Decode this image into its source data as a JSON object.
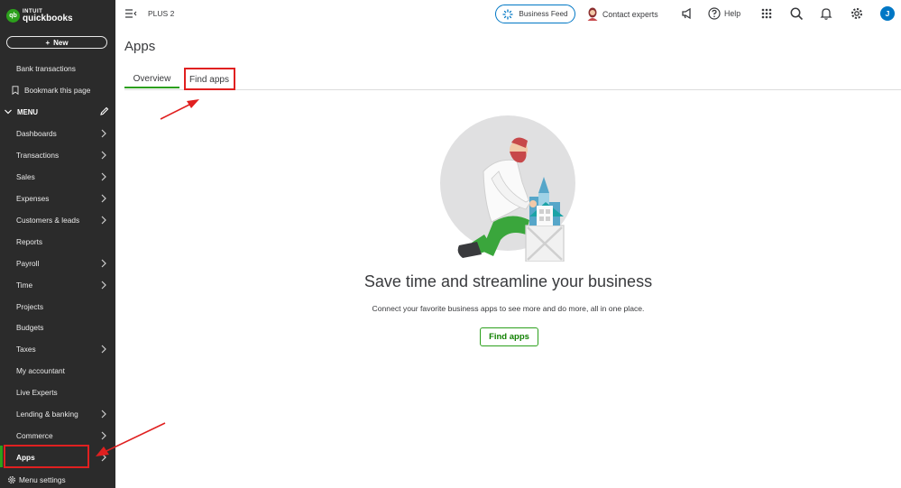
{
  "brand": {
    "intuit": "INTUIT",
    "product": "quickbooks",
    "mark": "qb",
    "accent": "#2ca01c"
  },
  "sidebar": {
    "new_label": "New",
    "bank_transactions": "Bank transactions",
    "bookmark": "Bookmark this page",
    "menu_label": "MENU",
    "items": [
      {
        "label": "Dashboards",
        "chevron": true
      },
      {
        "label": "Transactions",
        "chevron": true
      },
      {
        "label": "Sales",
        "chevron": true
      },
      {
        "label": "Expenses",
        "chevron": true
      },
      {
        "label": "Customers & leads",
        "chevron": true
      },
      {
        "label": "Reports",
        "chevron": false
      },
      {
        "label": "Payroll",
        "chevron": true
      },
      {
        "label": "Time",
        "chevron": true
      },
      {
        "label": "Projects",
        "chevron": false
      },
      {
        "label": "Budgets",
        "chevron": false
      },
      {
        "label": "Taxes",
        "chevron": true
      },
      {
        "label": "My accountant",
        "chevron": false
      },
      {
        "label": "Live Experts",
        "chevron": false
      },
      {
        "label": "Lending & banking",
        "chevron": true
      },
      {
        "label": "Commerce",
        "chevron": true
      },
      {
        "label": "Apps",
        "chevron": true,
        "active": true
      }
    ],
    "menu_settings": "Menu settings"
  },
  "topbar": {
    "plan": "PLUS 2",
    "business_feed": "Business Feed",
    "contact_experts": "Contact experts",
    "help": "Help",
    "user_initial": "J"
  },
  "main": {
    "title": "Apps",
    "tabs": [
      {
        "label": "Overview",
        "active": true
      },
      {
        "label": "Find apps",
        "active": false
      }
    ],
    "headline": "Save time and streamline your business",
    "subtext": "Connect your favorite business apps to see more and do more, all in one place.",
    "cta": "Find apps"
  },
  "annotation_color": "#e02020"
}
